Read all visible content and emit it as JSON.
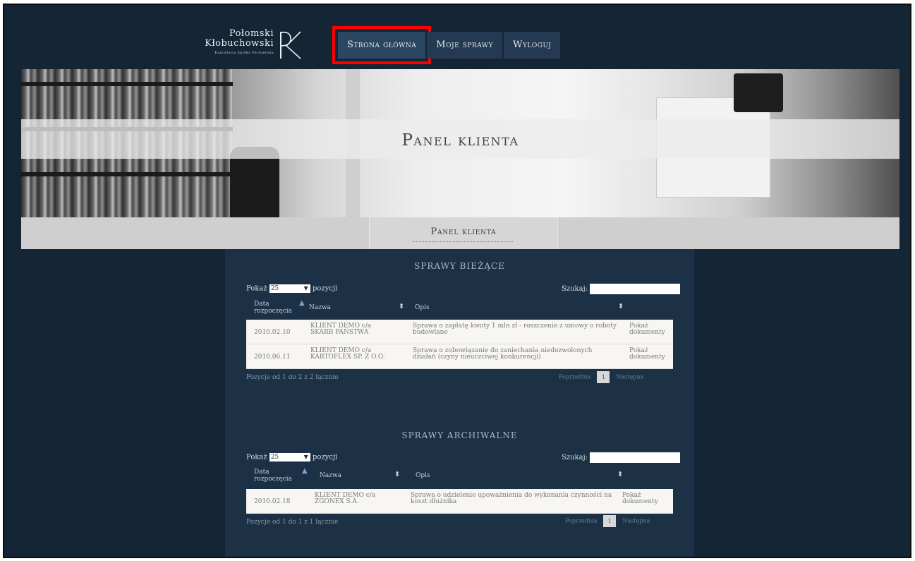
{
  "logo": {
    "line1": "Połomski",
    "line2": "Kłobuchowski",
    "sub": "Kancelaria Spółka Partnerska",
    "monogram": "PK"
  },
  "nav": {
    "home": "Strona główna",
    "my_cases": "Moje sprawy",
    "logout": "Wyloguj"
  },
  "hero": {
    "title": "Panel klienta"
  },
  "subnav": {
    "label": "Panel klienta"
  },
  "current": {
    "title": "SPRAWY BIEŻĄCE",
    "show_label": "Pokaż",
    "show_value": "25",
    "show_suffix": "pozycji",
    "search_label": "Szukaj:",
    "columns": {
      "date": "Data rozpoczęcia",
      "name": "Nazwa",
      "desc": "Opis"
    },
    "rows": [
      {
        "date": "2010.02.10",
        "name": "KLIENT DEMO c/a SKARB PAŃSTWA",
        "desc": "Sprawa o zapłatę kwoty 1 mln zł - roszczenie z umowy o roboty budowlane",
        "action": "Pokaż dokumenty"
      },
      {
        "date": "2010.06.11",
        "name": "KLIENT DEMO c/a KARTOFLEX SP. Z O.O.",
        "desc": "Sprawa o zobowiązanie do zaniechania niedozwolonych działań (czyny nieuczciwej konkurencji)",
        "action": "Pokaż dokumenty"
      }
    ],
    "info": "Pozycje od 1 do 2 z 2 łącznie",
    "prev": "Poprzednia",
    "page": "1",
    "next": "Następna"
  },
  "archive": {
    "title": "SPRAWY ARCHIWALNE",
    "show_label": "Pokaż",
    "show_value": "25",
    "show_suffix": "pozycji",
    "search_label": "Szukaj:",
    "columns": {
      "date": "Data rozpoczęcia",
      "name": "Nazwa",
      "desc": "Opis"
    },
    "rows": [
      {
        "date": "2010.02.18",
        "name": "KLIENT DEMO c/a ZGONEX S.A.",
        "desc": "Sprawa o udzielenie upoważnienia do wykonania czynności na koszt dłużnika",
        "action": "Pokaż dokumenty"
      }
    ],
    "info": "Pozycje od 1 do 1 z 1 łącznie",
    "prev": "Poprzednia",
    "page": "1",
    "next": "Następna"
  }
}
